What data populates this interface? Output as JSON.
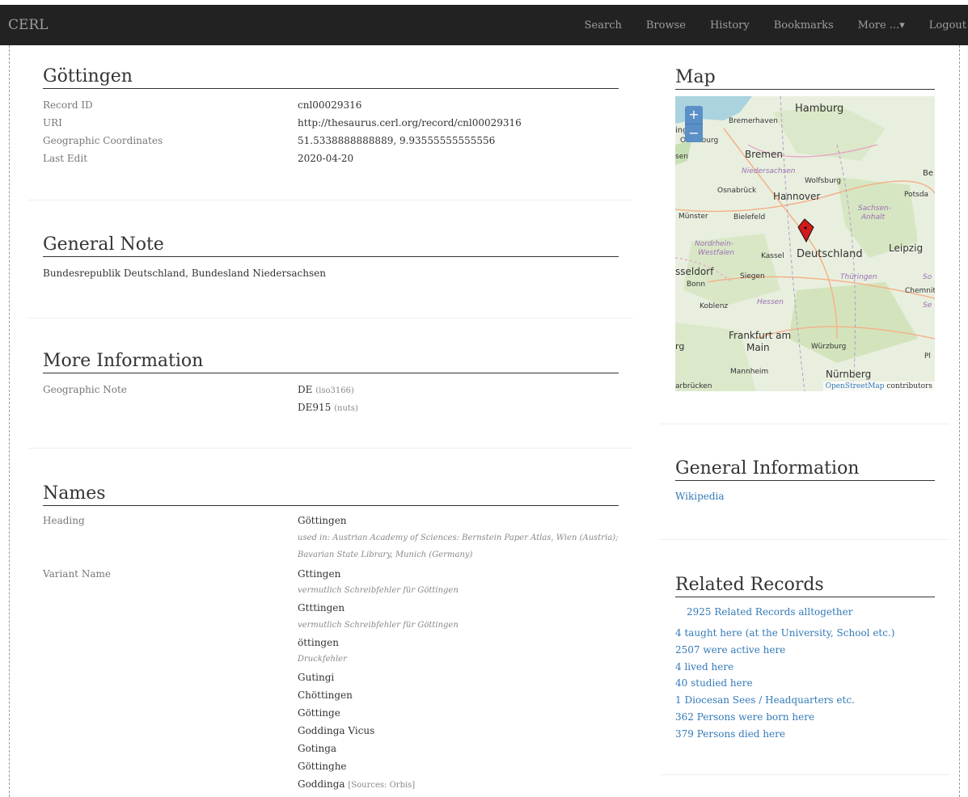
{
  "navbar": {
    "brand": "CERL",
    "items": [
      "Search",
      "Browse",
      "History",
      "Bookmarks",
      "More ...▾",
      "Logout"
    ]
  },
  "record": {
    "title": "Göttingen",
    "fields": [
      {
        "label": "Record ID",
        "value": "cnl00029316"
      },
      {
        "label": "URI",
        "value": "http://thesaurus.cerl.org/record/cnl00029316"
      },
      {
        "label": "Geographic Coordinates",
        "value": "51.5338888888889, 9.93555555555556"
      },
      {
        "label": "Last Edit",
        "value": "2020-04-20"
      }
    ]
  },
  "general_note": {
    "title": "General Note",
    "text": "Bundesrepublik Deutschland, Bundesland Niedersachsen"
  },
  "more_info": {
    "title": "More Information",
    "label": "Geographic Note",
    "values": [
      {
        "value": "DE",
        "source": "(iso3166)"
      },
      {
        "value": "DE915",
        "source": "(nuts)"
      }
    ]
  },
  "names": {
    "title": "Names",
    "heading_label": "Heading",
    "heading_value": "Göttingen",
    "heading_note_1": "used in: Austrian Academy of Sciences: Bernstein Paper Atlas, Wien (Austria);",
    "heading_note_2": "Bavarian State Library, Munich (Germany)",
    "variant_label": "Variant Name",
    "variants": [
      {
        "name": "Gttingen",
        "note": "vermutlich Schreibfehler für Göttingen"
      },
      {
        "name": "Gtttingen",
        "note": "vermutlich Schreibfehler für Göttingen"
      },
      {
        "name": "öttingen",
        "note": "Druckfehler"
      },
      {
        "name": "Gutingi"
      },
      {
        "name": "Chöttingen"
      },
      {
        "name": "Göttinge"
      },
      {
        "name": "Goddinga Vicus"
      },
      {
        "name": "Gotinga"
      },
      {
        "name": "Göttinghe"
      },
      {
        "name": "Goddinga",
        "source": "[Sources: Orbis]"
      }
    ]
  },
  "map": {
    "title": "Map",
    "zoom_in": "+",
    "zoom_out": "−",
    "attribution_link": "OpenStreetMap",
    "attribution_rest": " contributors",
    "labels": {
      "hamburg": "Hamburg",
      "bremerhaven": "Bremerhaven",
      "oldenburg": "Oldenburg",
      "bremen": "Bremen",
      "niedersachsen": "Niedersachsen",
      "wolfsburg": "Wolfsburg",
      "osnabrueck": "Osnabrück",
      "hannover": "Hannover",
      "potsdam": "Potsda",
      "muenster": "Münster",
      "bielefeld": "Bielefeld",
      "sachsen_anhalt_1": "Sachsen-",
      "sachsen_anhalt_2": "Anhalt",
      "nrw_1": "Nordrhein-",
      "nrw_2": "Westfalen",
      "kassel": "Kassel",
      "deutschland": "Deutschland",
      "leipzig": "Leipzig",
      "duesseldorf": "sseldorf",
      "siegen": "Siegen",
      "bonn": "Bonn",
      "thueringen": "Thüringen",
      "chemnitz": "Chemnit",
      "koblenz": "Koblenz",
      "hessen": "Hessen",
      "frankfurt_1": "Frankfurt am",
      "frankfurt_2": "Main",
      "wuerzburg": "Würzburg",
      "mannheim": "Mannheim",
      "nuernberg": "Nürnberg",
      "ingen": "ingen",
      "sen": "sen",
      "be": "Be",
      "rg": "rg",
      "arbruecken": "arbrücken",
      "so": "So",
      "se": "Se",
      "pl": "Pl"
    }
  },
  "general_information": {
    "title": "General Information",
    "link": "Wikipedia"
  },
  "related": {
    "title": "Related Records",
    "links": [
      "2925 Related Records alltogether",
      "4 taught here (at the University, School etc.)",
      "2507 were active here",
      "4 lived here",
      "40 studied here",
      "1 Diocesan Sees / Headquarters etc.",
      "362 Persons were born here",
      "379 Persons died here"
    ]
  },
  "colors": {
    "navbar": "#222222",
    "link": "#337ab7",
    "label": "#777777",
    "marker": "#d11b1b"
  }
}
